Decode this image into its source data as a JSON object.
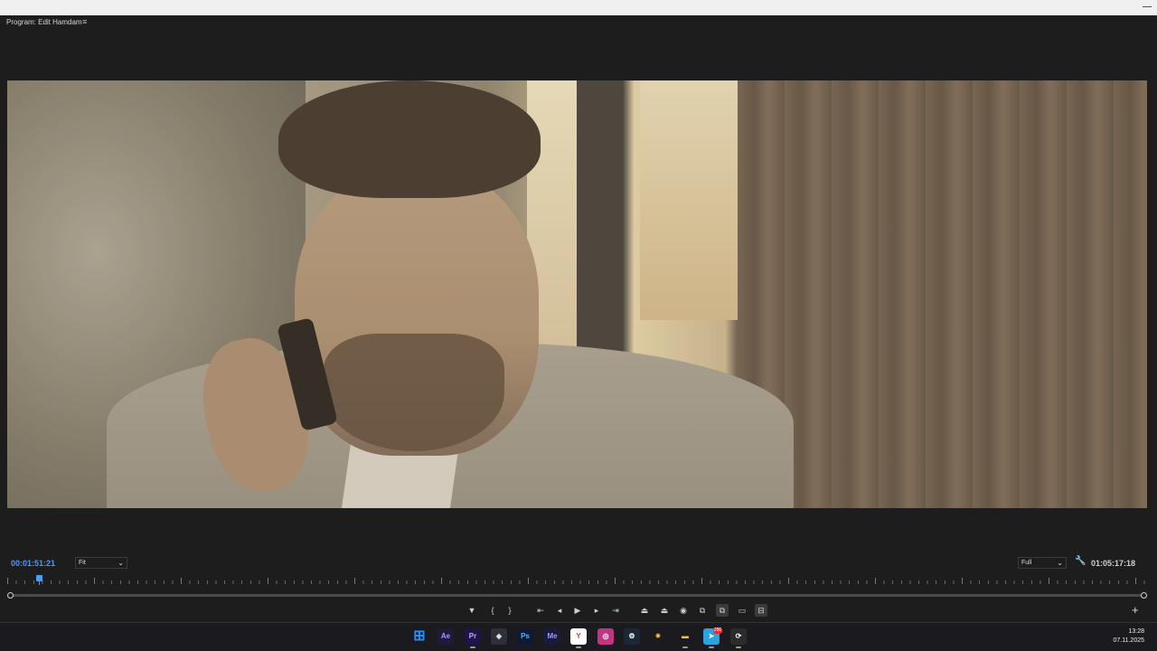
{
  "panel": {
    "title": "Program: Edit Hamdam",
    "menu_icon": "menu-icon"
  },
  "viewer": {
    "current_timecode": "00:01:51:21",
    "zoom_option": "Fit",
    "resolution_option": "Full",
    "duration_timecode": "01:05:17:18",
    "settings_icon": "wrench-icon"
  },
  "transport": {
    "buttons": [
      {
        "name": "add-marker-button",
        "icon": "marker-icon",
        "glyph": "▼"
      },
      {
        "name": "mark-in-button",
        "icon": "mark-in-icon",
        "glyph": "{"
      },
      {
        "name": "mark-out-button",
        "icon": "mark-out-icon",
        "glyph": "}"
      },
      {
        "name": "go-to-in-button",
        "icon": "go-to-in-icon",
        "glyph": "⇤"
      },
      {
        "name": "step-back-button",
        "icon": "step-back-icon",
        "glyph": "◂"
      },
      {
        "name": "play-button",
        "icon": "play-icon",
        "glyph": "▶"
      },
      {
        "name": "step-forward-button",
        "icon": "step-forward-icon",
        "glyph": "▸"
      },
      {
        "name": "go-to-out-button",
        "icon": "go-to-out-icon",
        "glyph": "⇥"
      },
      {
        "name": "lift-button",
        "icon": "lift-icon",
        "glyph": "⏏"
      },
      {
        "name": "extract-button",
        "icon": "extract-icon",
        "glyph": "⏏"
      },
      {
        "name": "export-frame-button",
        "icon": "camera-icon",
        "glyph": "◉"
      },
      {
        "name": "insert-button",
        "icon": "insert-icon",
        "glyph": "⧉"
      },
      {
        "name": "overwrite-button",
        "icon": "overwrite-icon",
        "glyph": "⧉"
      },
      {
        "name": "safe-margins-button",
        "icon": "safe-margins-icon",
        "glyph": "▭"
      },
      {
        "name": "comparison-view-button",
        "icon": "comparison-icon",
        "glyph": "⊟"
      }
    ],
    "add_button_label": "+"
  },
  "taskbar": {
    "apps": [
      {
        "name": "start-button",
        "label": "⊞",
        "color": "#1e90ff",
        "bg": "transparent",
        "icon": "windows-icon"
      },
      {
        "name": "after-effects-app",
        "label": "Ae",
        "color": "#a59bff",
        "bg": "#1d1a3b",
        "icon": "after-effects-icon"
      },
      {
        "name": "premiere-app",
        "label": "Pr",
        "color": "#c6a8ff",
        "bg": "#1f1447",
        "icon": "premiere-icon"
      },
      {
        "name": "davinci-app",
        "label": "◈",
        "color": "#e8e8e8",
        "bg": "#2d2f3a",
        "icon": "davinci-icon"
      },
      {
        "name": "photoshop-app",
        "label": "Ps",
        "color": "#5fb3ff",
        "bg": "#0c1b33",
        "icon": "photoshop-icon"
      },
      {
        "name": "media-encoder-app",
        "label": "Me",
        "color": "#9a9aff",
        "bg": "#1a1a3d",
        "icon": "media-encoder-icon"
      },
      {
        "name": "yandex-browser-app",
        "label": "Y",
        "color": "#e03b3b",
        "bg": "#ffffff",
        "icon": "yandex-icon"
      },
      {
        "name": "instagram-app",
        "label": "◎",
        "color": "#ffffff",
        "bg": "#c13584",
        "icon": "instagram-icon"
      },
      {
        "name": "steam-app",
        "label": "⚙",
        "color": "#ffffff",
        "bg": "#1b2838",
        "icon": "steam-icon"
      },
      {
        "name": "star-app",
        "label": "✷",
        "color": "#f5c542",
        "bg": "#1b1a1e",
        "icon": "star-icon"
      },
      {
        "name": "file-explorer-app",
        "label": "▬",
        "color": "#f2c14e",
        "bg": "#1b1a1e",
        "icon": "folder-icon"
      },
      {
        "name": "telegram-app",
        "label": "➤",
        "color": "#ffffff",
        "bg": "#2aa3de",
        "icon": "telegram-icon"
      },
      {
        "name": "recorder-app",
        "label": "⟳",
        "color": "#ffffff",
        "bg": "#2b2b2b",
        "icon": "recorder-icon"
      }
    ],
    "badge_count": "296",
    "clock_time": "13:28",
    "clock_date": "07.11.2025"
  }
}
